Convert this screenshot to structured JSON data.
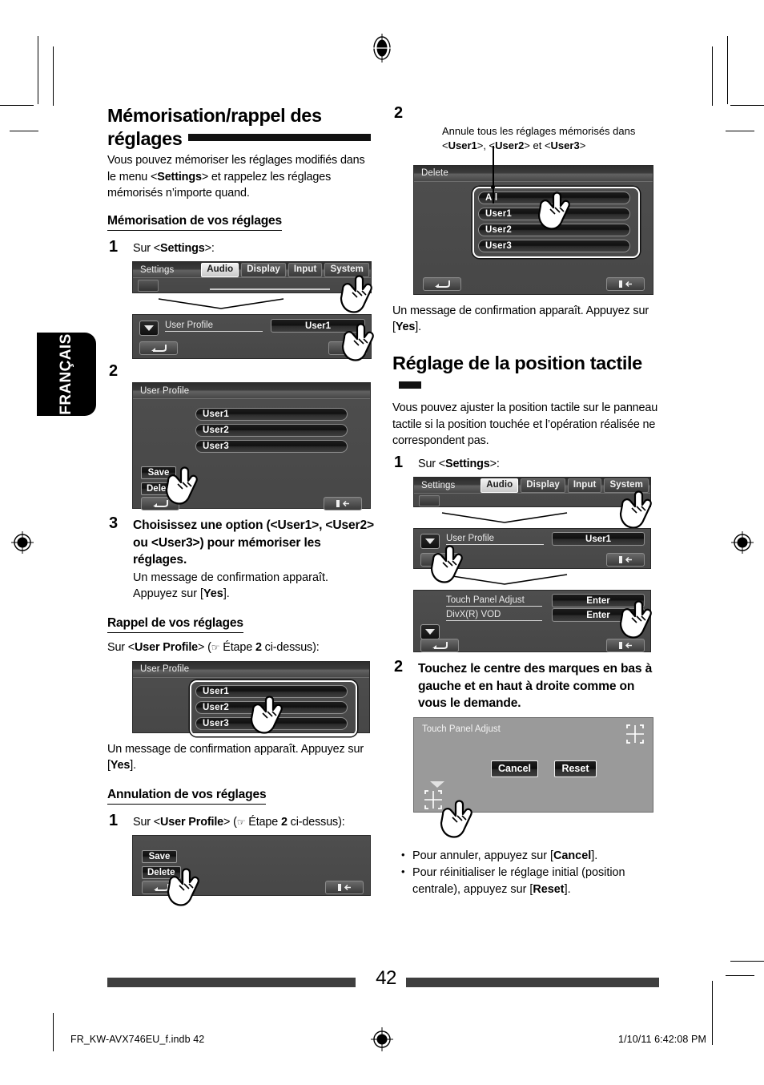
{
  "page": {
    "number": "42",
    "language_tab": "FRANÇAIS",
    "footer_file": "FR_KW-AVX746EU_f.indb   42",
    "footer_date": "1/10/11   6:42:08 PM"
  },
  "left": {
    "title": "Mémorisation/rappel des réglages",
    "intro_1": "Vous pouvez mémoriser les réglages modifiés dans le menu <",
    "intro_settings": "Settings",
    "intro_2": "> et rappelez les réglages mémorisés n’importe quand.",
    "sub1": "Mémorisation de vos réglages",
    "step1_num": "1",
    "step1_prefix": "Sur <",
    "step1_bold": "Settings",
    "step1_suffix": ">:",
    "step2_num": "2",
    "step3_num": "3",
    "step3_text": "Choisissez une option (<User1>, <User2> ou <User3>) pour mémoriser les réglages.",
    "step3_note_a": "Un message de confirmation apparaît. Appuyez sur [",
    "step3_note_yes": "Yes",
    "step3_note_b": "].",
    "sub2": "Rappel de vos réglages",
    "recall_line_a": "Sur <",
    "recall_line_bold": "User Profile",
    "recall_line_b": "> (",
    "recall_line_etape": "Étape ",
    "recall_line_step": "2",
    "recall_line_c": " ci-dessus):",
    "recall_note_a": "Un message de confirmation apparaît. Appuyez sur [",
    "recall_note_yes": "Yes",
    "recall_note_b": "].",
    "sub3": "Annulation de vos réglages",
    "cancel_step_num": "1",
    "cancel_line_a": "Sur <",
    "cancel_line_bold": "User Profile",
    "cancel_line_b": "> (",
    "cancel_line_etape": "Étape ",
    "cancel_line_step": "2",
    "cancel_line_c": " ci-dessus):"
  },
  "right": {
    "step2_num": "2",
    "delete_caption_1": "Annule tous les réglages mémorisés dans",
    "delete_caption_u1": "User1",
    "delete_caption_sep": ">, <",
    "delete_caption_u2": "User2",
    "delete_caption_et": "> et <",
    "delete_caption_u3": "User3",
    "delete_caption_end": ">",
    "delete_note_a": "Un message de confirmation apparaît. Appuyez sur [",
    "delete_note_yes": "Yes",
    "delete_note_b": "].",
    "title": "Réglage de la position tactile",
    "intro": "Vous pouvez ajuster la position tactile sur le panneau tactile si la position touchée et l’opération réalisée ne correspondent pas.",
    "step1_num": "1",
    "step1_prefix": "Sur <",
    "step1_bold": "Settings",
    "step1_suffix": ">:",
    "step2b_num": "2",
    "step2b_text": "Touchez le centre des marques en bas à gauche et en haut à droite comme on vous le demande.",
    "bullet1_a": "Pour annuler, appuyez sur [",
    "bullet1_bold": "Cancel",
    "bullet1_b": "].",
    "bullet2_a": "Pour réinitialiser le réglage initial (position centrale), appuyez sur [",
    "bullet2_bold": "Reset",
    "bullet2_b": "]."
  },
  "screens": {
    "settings": {
      "title": "Settings",
      "tabs": [
        "Audio",
        "Display",
        "Input",
        "System"
      ],
      "active_tab": "Audio"
    },
    "user_profile_row": {
      "label": "User Profile",
      "value": "User1"
    },
    "user_profile_list": {
      "title": "User Profile",
      "items": [
        "User1",
        "User2",
        "User3"
      ],
      "save": "Save",
      "delete": "Delete"
    },
    "delete_list": {
      "title": "Delete",
      "items": [
        "All",
        "User1",
        "User2",
        "User3"
      ]
    },
    "system_menu": {
      "rows": [
        {
          "label": "Touch Panel Adjust",
          "button": "Enter"
        },
        {
          "label": "DivX(R) VOD",
          "button": "Enter"
        }
      ]
    },
    "touch_panel_adjust": {
      "title": "Touch Panel Adjust",
      "cancel": "Cancel",
      "reset": "Reset"
    }
  }
}
